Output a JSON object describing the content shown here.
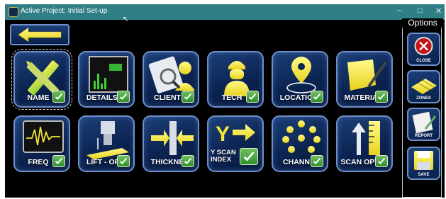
{
  "window": {
    "title": "Active Project: Initial Set-up",
    "controls": {
      "minimize": "–",
      "maximize": "□",
      "close": "✕"
    }
  },
  "back_button": {
    "icon": "arrow-left-icon"
  },
  "tiles": {
    "name": {
      "label": "NAME",
      "icon": "ruler-pencil-icon"
    },
    "details": {
      "label": "DETAILS",
      "icon": "monitor-bars-icon"
    },
    "client": {
      "label": "CLIENT",
      "icon": "client-magnifier-icon"
    },
    "tech": {
      "label": "TECH",
      "icon": "hardhat-worker-icon"
    },
    "location": {
      "label": "LOCATIO",
      "icon": "map-pin-icon"
    },
    "material": {
      "label": "MATERIA",
      "icon": "material-pen-icon"
    },
    "freq": {
      "label": "FREQ",
      "icon": "waveform-screen-icon"
    },
    "liftoff": {
      "label": "LIFT - OF",
      "icon": "probe-liftoff-icon"
    },
    "thickness": {
      "label": "THICKNE",
      "icon": "thickness-arrows-icon"
    },
    "yscan": {
      "label_line1": "Y SCAN",
      "label_line2": "INDEX",
      "icon": "y-scan-arrow-icon"
    },
    "channels": {
      "label": "CHANN",
      "icon": "channel-dots-icon"
    },
    "scanopt": {
      "label": "SCAN OPTI",
      "icon": "scan-ruler-icon"
    }
  },
  "options": {
    "title": "Options",
    "close": {
      "label": "CLOSE",
      "icon": "close-x-icon"
    },
    "zones": {
      "label": "ZONES",
      "icon": "zones-grid-icon"
    },
    "report": {
      "label": "REPORT",
      "icon": "report-notepad-icon"
    },
    "save": {
      "label": "SAVE",
      "icon": "save-disk-icon"
    }
  },
  "colors": {
    "titlebar": "#2f7f86",
    "tile_border": "#6f8fc8",
    "check_green": "#3fa535",
    "icon_yellow": "#f2e637"
  }
}
